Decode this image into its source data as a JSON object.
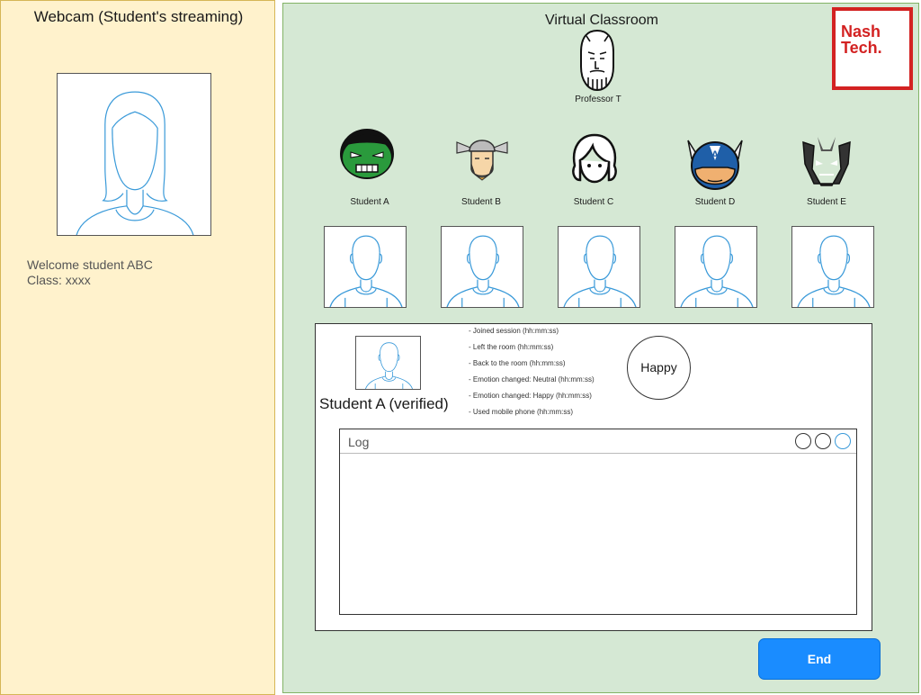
{
  "left_panel": {
    "title": "Webcam (Student's streaming)",
    "welcome": "Welcome student ABC",
    "class_info": "Class: xxxx"
  },
  "classroom": {
    "title": "Virtual Classroom",
    "logo": {
      "line1": "Nash",
      "line2": "Tech."
    },
    "professor": {
      "name": "Professor T",
      "icon": "bald-bearded-professor-icon"
    },
    "students": [
      {
        "name": "Student A",
        "icon": "hulk-avatar-icon"
      },
      {
        "name": "Student B",
        "icon": "thor-avatar-icon"
      },
      {
        "name": "Student C",
        "icon": "girl-outline-avatar-icon"
      },
      {
        "name": "Student D",
        "icon": "captain-america-avatar-icon"
      },
      {
        "name": "Student E",
        "icon": "ultron-avatar-icon"
      }
    ]
  },
  "detail": {
    "student_label": "Student A (verified)",
    "events": [
      "- Joined session (hh:mm:ss)",
      "- Left the room (hh:mm:ss)",
      "- Back to the room (hh:mm:ss)",
      "- Emotion changed: Neutral (hh:mm:ss)",
      "- Emotion changed: Happy (hh:mm:ss)",
      "- Used mobile phone (hh:mm:ss)"
    ],
    "emotion": "Happy",
    "log_title": "Log"
  },
  "actions": {
    "end_label": "End"
  },
  "colors": {
    "left_bg": "#fff2cc",
    "right_bg": "#d5e8d4",
    "brand_red": "#d32222",
    "button_blue": "#1a8cff",
    "outline_blue": "#3a9ad9"
  }
}
